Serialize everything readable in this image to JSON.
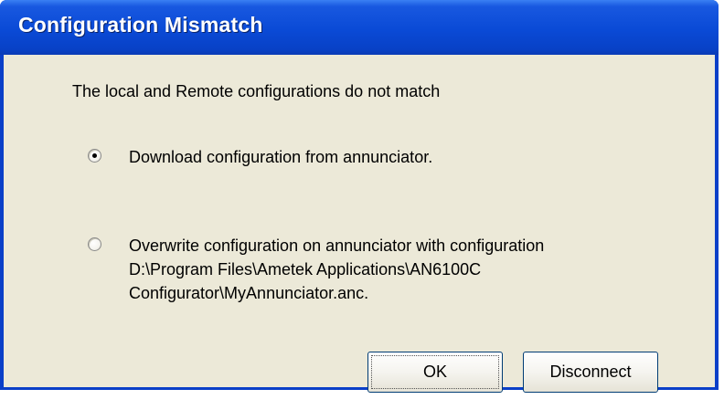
{
  "dialog": {
    "title": "Configuration Mismatch",
    "message": "The local and Remote configurations do not match",
    "options": [
      {
        "label_lines": [
          "Download configuration from annunciator."
        ],
        "selected": true
      },
      {
        "label_lines": [
          "Overwrite configuration on annunciator with configuration",
          "D:\\Program Files\\Ametek Applications\\AN6100C",
          "Configurator\\MyAnnunciator.anc."
        ],
        "selected": false
      }
    ],
    "buttons": {
      "ok": "OK",
      "disconnect": "Disconnect"
    }
  }
}
